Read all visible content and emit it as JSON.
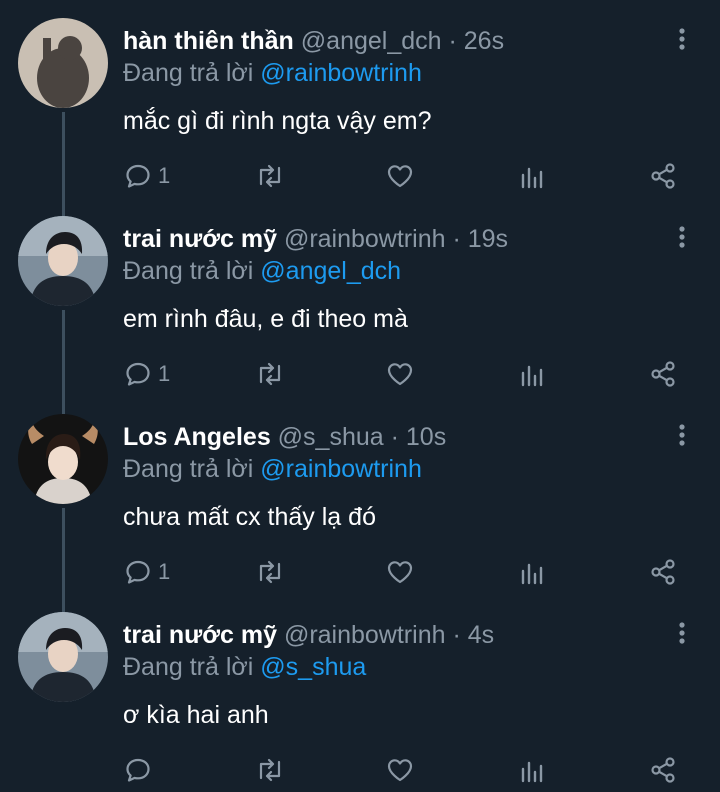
{
  "tweets": [
    {
      "name": "hàn thiên thần",
      "handle": "@angel_dch",
      "sep": "·",
      "time": "26s",
      "replying_prefix": "Đang trả lời",
      "replying_to": "@rainbowtrinh",
      "text": "mắc gì đi rình ngta vậy em?",
      "reply_count": "1"
    },
    {
      "name": "trai nước mỹ",
      "handle": "@rainbowtrinh",
      "sep": "·",
      "time": "19s",
      "replying_prefix": "Đang trả lời",
      "replying_to": "@angel_dch",
      "text": "em rình đâu, e đi theo mà",
      "reply_count": "1"
    },
    {
      "name": "Los Angeles",
      "handle": "@s_shua",
      "sep": "·",
      "time": "10s",
      "replying_prefix": "Đang trả lời",
      "replying_to": "@rainbowtrinh",
      "text": "chưa mất cx thấy lạ đó",
      "reply_count": "1"
    },
    {
      "name": "trai nước mỹ",
      "handle": "@rainbowtrinh",
      "sep": "·",
      "time": "4s",
      "replying_prefix": "Đang trả lời",
      "replying_to": "@s_shua",
      "text": "ơ kìa hai anh",
      "reply_count": ""
    }
  ],
  "colors": {
    "background": "#15202b",
    "text_primary": "#ffffff",
    "text_muted": "#8b98a5",
    "mention": "#1d9bf0",
    "thread_line": "#3d4f5e"
  },
  "icons": {
    "reply": "reply-bubble-icon",
    "retweet": "retweet-icon",
    "like": "heart-icon",
    "stats": "stats-bars-icon",
    "share": "share-icon",
    "more": "more-vertical-icon"
  }
}
